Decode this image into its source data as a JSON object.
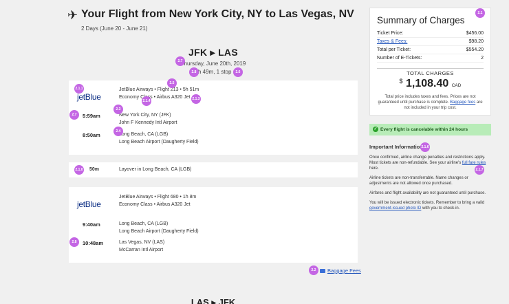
{
  "header": {
    "plane_icon": "airplane-icon",
    "title": "Your Flight from New York City, NY to Las Vegas, NV",
    "dates": "2 Days (June 20 - June 21)"
  },
  "route": {
    "title": "JFK ▸ LAS",
    "date": "Thursday, June 20th, 2019",
    "duration": "4h 49m, 1 stop"
  },
  "segment1": {
    "airline": "jetBlue",
    "flight": "JetBlue Airways • Flight 213 • 5h 51m",
    "cabin": "Economy Class • Airbus A320 Jet",
    "dep_time": "5:59am",
    "dep_city": "New York City, NY (JFK)",
    "dep_airport": "John F Kennedy Intl Airport",
    "arr_time": "8:50am",
    "arr_city": "Long Beach, CA (LGB)",
    "arr_airport": "Long Beach Airport (Daugherty Field)"
  },
  "layover": {
    "duration": "50m",
    "text": "Layover in Long Beach, CA (LGB)"
  },
  "segment2": {
    "airline": "jetBlue",
    "flight": "JetBlue Airways • Flight 680 • 1h 8m",
    "cabin": "Economy Class • Airbus A320 Jet",
    "dep_time": "9:40am",
    "dep_city": "Long Beach, CA (LGB)",
    "dep_airport": "Long Beach Airport (Daugherty Field)",
    "arr_time": "10:48am",
    "arr_city": "Las Vegas, NV (LAS)",
    "arr_airport": "McCarran Intl Airport"
  },
  "baggage_link": "Baggage Fees",
  "next_route": "LAS ▸ JFK",
  "summary": {
    "title": "Summary of Charges",
    "rows": [
      {
        "label": "Ticket Price:",
        "value": "$456.00"
      },
      {
        "label": "Taxes & Fees:",
        "value": "$98.20"
      },
      {
        "label": "Total per Ticket:",
        "value": "$554.20"
      },
      {
        "label": "Number of E-Tickets:",
        "value": "2"
      }
    ],
    "total_label": "TOTAL CHARGES",
    "currency_symbol": "$",
    "total_amount": "1,108.40",
    "currency_code": "CAD",
    "note_pre": "Total price includes taxes and fees. Prices are not guaranteed until purchase is complete. ",
    "note_link": "Baggage fees",
    "note_post": " are not included in your trip cost."
  },
  "cancel_banner": "Every flight is cancelable within 24 hours",
  "important": {
    "title": "Important Information",
    "p1_pre": "Once confirmed, airline change penalties and restrictions apply. Most tickets are non-refundable. See your airline's ",
    "p1_link": "full fare rules",
    "p1_post": " here.",
    "p2": "Airline tickets are non-transferrable. Name changes or adjustments are not allowed once purchased.",
    "p3": "Airfares and flight availability are not guaranteed until purchase.",
    "p4_pre": "You will be issued electronic tickets. Remember to bring a valid ",
    "p4_link": "government-issued photo ID",
    "p4_post": " with you to check-in."
  },
  "markers": {
    "m_summary": "2.1",
    "m_route_date": "2.7",
    "m_duration1": "2.8",
    "m_duration2": "2.6",
    "m_flight": "2.5",
    "m_logo": "2.1.1",
    "m_cabin1": "2.1.4",
    "m_cabin2": "2.1.3",
    "m_dep_city": "2.3",
    "m_dep_time": "2.7",
    "m_arr_city": "2.4",
    "m_layover": "2.1.0",
    "m_arr_time2": "2.8",
    "m_baggage": "2.2",
    "m_important": "2.1.6",
    "m_fare_rules": "2.1.7"
  }
}
